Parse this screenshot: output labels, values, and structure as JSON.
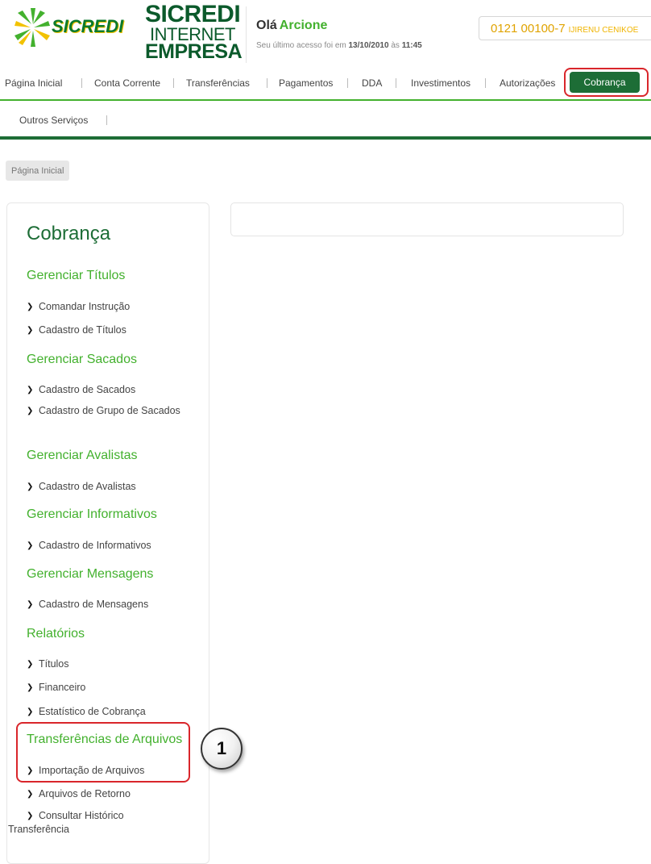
{
  "header": {
    "logo_wordmark": "SICREDI",
    "product_line1": "SICREDI",
    "product_line2": "INTERNET",
    "product_line3": "EMPRESA",
    "greeting_prefix": "Olá",
    "user_name": "Arcione",
    "last_access_prefix": "Seu último acesso foi em",
    "last_access_date": "13/10/2010",
    "last_access_mid": "às",
    "last_access_time": "11:45",
    "account_number": "0121 00100-7",
    "account_holder": "IJIRENU CENIKOE"
  },
  "nav": {
    "items": [
      "Página Inicial",
      "Conta Corrente",
      "Transferências",
      "Pagamentos",
      "DDA",
      "Investimentos",
      "Autorizações"
    ],
    "active": "Cobrança",
    "sub_items": [
      "Outros Serviços"
    ]
  },
  "breadcrumb": "Página Inicial",
  "sidebar": {
    "title": "Cobrança",
    "sections": [
      {
        "heading": "Gerenciar Títulos",
        "links": [
          "Comandar Instrução",
          "Cadastro de Títulos"
        ]
      },
      {
        "heading": "Gerenciar Sacados",
        "links": [
          "Cadastro de Sacados",
          "Cadastro de Grupo de Sacados"
        ]
      },
      {
        "heading": "Gerenciar Avalistas",
        "links": [
          "Cadastro de Avalistas"
        ]
      },
      {
        "heading": "Gerenciar Informativos",
        "links": [
          "Cadastro de Informativos"
        ]
      },
      {
        "heading": "Gerenciar Mensagens",
        "links": [
          "Cadastro de Mensagens"
        ]
      },
      {
        "heading": "Relatórios",
        "links": [
          "Títulos",
          "Financeiro",
          "Estatístico de Cobrança"
        ]
      },
      {
        "heading": "Transferências de Arquivos",
        "links": [
          "Importação de Arquivos",
          "Arquivos de Retorno",
          "Consultar Histórico Transferência"
        ]
      }
    ]
  },
  "annotation": {
    "step_number": "1"
  },
  "colors": {
    "brand_green": "#1d6d36",
    "accent_green": "#43b12e",
    "highlight_red": "#d9262b",
    "account_yellow": "#e0a300"
  },
  "icons": [
    "sicredi-logo-icon",
    "chevron-right-icon"
  ]
}
